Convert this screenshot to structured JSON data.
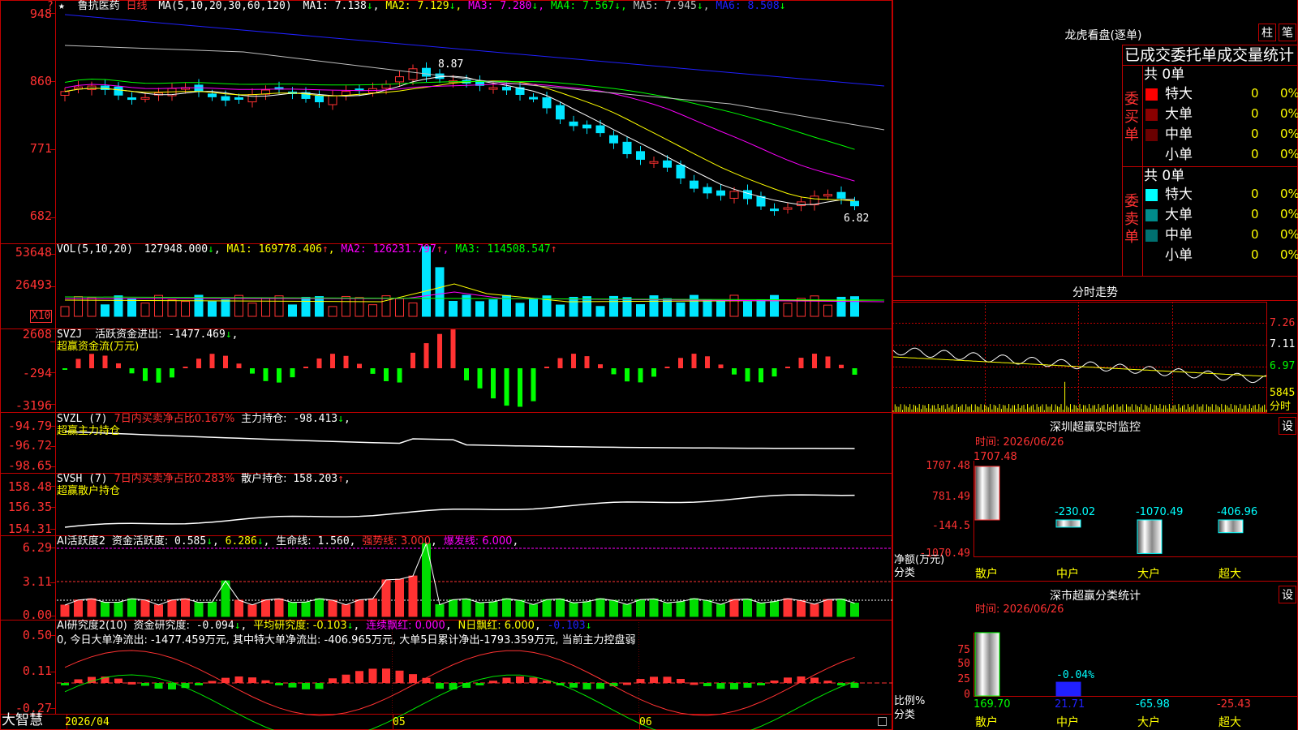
{
  "app": {
    "brand": "大智慧",
    "star": "★",
    "question": "?"
  },
  "colors": {
    "up": "#ff3232",
    "down": "#00e5ff",
    "grid": "#c00000",
    "ma1": "#ffffff",
    "ma2": "#ffff00",
    "ma3": "#ff00ff",
    "ma4": "#00ff00",
    "ma5": "#c0c0c0",
    "ma6": "#2020ff"
  },
  "kline": {
    "stock": "鲁抗医药",
    "period": "日线",
    "ma_label": "MA(5,10,20,30,60,120)",
    "ma": [
      {
        "label": "MA1:",
        "value": "7.138",
        "arrow": "↓"
      },
      {
        "label": "MA2:",
        "value": "7.129",
        "arrow": "↓"
      },
      {
        "label": "MA3:",
        "value": "7.280",
        "arrow": "↓"
      },
      {
        "label": "MA4:",
        "value": "7.567",
        "arrow": "↓"
      },
      {
        "label": "MA5:",
        "value": "7.945",
        "arrow": "↓"
      },
      {
        "label": "MA6:",
        "value": "8.508",
        "arrow": "↓"
      }
    ],
    "yticks": [
      "948",
      "860",
      "771",
      "682"
    ],
    "high_label": "8.87",
    "low_label": "6.82"
  },
  "vol": {
    "label": "VOL(5,10,20)",
    "value": "127948.000",
    "arrow": "↓",
    "ma": [
      {
        "label": "MA1:",
        "value": "169778.406",
        "arrow": "↑"
      },
      {
        "label": "MA2:",
        "value": "126231.797",
        "arrow": "↑"
      },
      {
        "label": "MA3:",
        "value": "114508.547",
        "arrow": "↑"
      }
    ],
    "yticks": [
      "53648",
      "26493"
    ],
    "unit": "X10"
  },
  "svzj": {
    "label": "SVZJ",
    "desc": "活跃资金进出:",
    "value": "-1477.469",
    "arrow": "↓",
    "tail": ",",
    "subtitle": "超赢资金流(万元)",
    "yticks": [
      "2608",
      "-294",
      "-3196"
    ]
  },
  "svzl": {
    "label": "SVZL (7)",
    "desc": "7日内买卖净占比0.167%",
    "desc2": "主力持仓:",
    "value": "-98.413",
    "arrow": "↓",
    "tail": ",",
    "subtitle": "超赢主力持仓",
    "yticks": [
      "-94.79",
      "-96.72",
      "-98.65"
    ]
  },
  "svsh": {
    "label": "SVSH (7)",
    "desc": "7日内买卖净占比0.283%",
    "desc2": "散户持仓:",
    "value": "158.203",
    "arrow": "↑",
    "tail": ",",
    "subtitle": "超赢散户持仓",
    "yticks": [
      "158.48",
      "156.35",
      "154.31"
    ]
  },
  "aihy": {
    "label": "AI活跃度2",
    "desc": "资金活跃度:",
    "value": "0.585",
    "arrow": "↓",
    "v2": "6.286",
    "desc3": "生命线:",
    "v3": "1.560",
    "strong": "强势线: 3.000",
    "burst": "爆发线: 6.000",
    "yticks": [
      "6.29",
      "3.11",
      "0.00"
    ]
  },
  "aiyj": {
    "label": "AI研究度2(10)",
    "desc": "资金研究度:",
    "value": "-0.094",
    "arrow": "↓",
    "avg": "平均研究度: -0.103",
    "avg_arrow": "↓",
    "red": "连续飘红: 0.000",
    "nred": "N日飘红: 6.000",
    "neg": "-0.103",
    "neg_arrow": "↓",
    "summary": "0, 今日大单净流出: -1477.459万元, 其中特大单净流出: -406.965万元, 大单5日累计净出-1793.359万元, 当前主力控盘弱",
    "yticks": [
      "0.50",
      "0.11",
      "-0.27"
    ]
  },
  "xaxis": [
    "2026/04",
    "05",
    "06"
  ],
  "lhb": {
    "title": "龙虎看盘(逐单)",
    "btn1": "柱",
    "btn2": "笔",
    "subtitle": "已成交委托单成交量统计",
    "buy": {
      "side": "委买单",
      "total": "共 0单",
      "rows": [
        {
          "name": "特大",
          "count": "0",
          "pct": "0%",
          "color": "#ff0000"
        },
        {
          "name": "大单",
          "count": "0",
          "pct": "0%",
          "color": "#8b0000"
        },
        {
          "name": "中单",
          "count": "0",
          "pct": "0%",
          "color": "#6a0000"
        },
        {
          "name": "小单",
          "count": "0",
          "pct": "0%",
          "color": "#000000"
        }
      ]
    },
    "sell": {
      "side": "委卖单",
      "total": "共 0单",
      "rows": [
        {
          "name": "特大",
          "count": "0",
          "pct": "0%",
          "color": "#00ffff"
        },
        {
          "name": "大单",
          "count": "0",
          "pct": "0%",
          "color": "#008b8b"
        },
        {
          "name": "中单",
          "count": "0",
          "pct": "0%",
          "color": "#007070"
        },
        {
          "name": "小单",
          "count": "0",
          "pct": "0%",
          "color": "#000000"
        }
      ]
    }
  },
  "fenshi": {
    "title": "分时走势",
    "yticks": [
      "7.26",
      "7.11",
      "6.97",
      "5845"
    ],
    "label": "分时"
  },
  "monitor": {
    "title": "深圳超赢实时监控",
    "btn": "设",
    "time": "时间: 2026/06/26",
    "yticks": [
      "1707.48",
      "781.49",
      "-144.5",
      "-1070.49"
    ],
    "ylabel": "净额(万元)",
    "xlabel": "分类",
    "bars": [
      {
        "name": "散户",
        "value": "1707.48",
        "v": 1707.48
      },
      {
        "name": "中户",
        "value": "-230.02",
        "v": -230.02
      },
      {
        "name": "大户",
        "value": "-1070.49",
        "v": -1070.49
      },
      {
        "name": "超大",
        "value": "-406.96",
        "v": -406.96
      }
    ]
  },
  "classify": {
    "title": "深市超赢分类统计",
    "btn": "设",
    "time": "时间: 2026/06/26",
    "yticks": [
      "75",
      "50",
      "25",
      "0"
    ],
    "ylabel": "比例%",
    "xlabel": "分类",
    "bar2_label": "-0.04%",
    "bars": [
      {
        "name": "散户",
        "value": "169.70",
        "v": 100
      },
      {
        "name": "中户",
        "value": "21.71",
        "v": 21.71
      },
      {
        "name": "大户",
        "value": "-65.98",
        "v": 0
      },
      {
        "name": "超大",
        "value": "-25.43",
        "v": 0
      }
    ]
  }
}
